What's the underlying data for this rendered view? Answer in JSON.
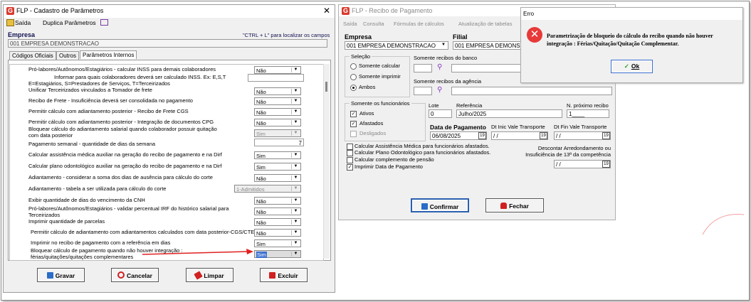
{
  "win1": {
    "title": "FLP - Cadastro de Parâmetros",
    "close": "✕",
    "toolbar": {
      "saida": "Saída",
      "duplica": "Duplica Parâmetros"
    },
    "empresa_label": "Empresa",
    "hint": "\"CTRL + L\" para localizar os campos",
    "empresa_value": "001 EMPRESA DEMONSTRACAO",
    "tabs": [
      "Códigos Oficiais",
      "Outros",
      "Parâmetros Internos"
    ],
    "rows": [
      {
        "text": "Pró-labores/Autônomos/Estagiários - calcular INSS para demais colaboradores",
        "value": "Não"
      },
      {
        "text": "Informar para quais colaboradores deverá ser calculado INSS. Ex: E,S,T",
        "value": ""
      },
      {
        "text": "E=Estagiários, S=Prestadores de Serviços, T=Terceirizados",
        "value": null
      },
      {
        "text": "Unificar Terceirizados vinculados a Tomador de frete",
        "value": "Não"
      },
      {
        "text": "Recibo de Frete - Insuficiência deverá ser consolidada no pagamento",
        "value": "Não"
      },
      {
        "text": "Permitir cálculo com adiantamento posterior - Recibo de Frete CGS",
        "value": "Não"
      },
      {
        "text": "Permitir cálculo com adiantamento posterior - Integração de documentos CPG",
        "value": "Não"
      },
      {
        "text": "Bloquear cálculo do adiantamento salarial quando colaborador possuir quitação",
        "value": "Sim"
      },
      {
        "text": "com data posterior",
        "value": null
      },
      {
        "text": "Pagamento semanal - quantidade de dias da  semana",
        "value": "7"
      },
      {
        "text": "Calcular assistência médica auxiliar na geração do recibo de pagamento e na Dirf",
        "value": "Sim"
      },
      {
        "text": "Calcular plano odontológico auxiliar na geração do recibo de pagamento e na Dirf",
        "value": "Sim"
      },
      {
        "text": "Adiantamento - considerar a soma dos dias de ausência para cálculo do corte",
        "value": "Não"
      },
      {
        "text": "Adiantamento - tabela a ser utilizada para cálculo do corte",
        "value": "1-Admitidos"
      },
      {
        "text": "Exibir quantidade de dias do vencimento da CNH",
        "value": "Não"
      },
      {
        "text": "Pró-labores/Autônomos/Estagiários - validar percentual IRF do  histórico salarial para",
        "value": "Não"
      },
      {
        "text": "Terceirizados",
        "value": null
      },
      {
        "text": "Imprimir quantidade de parcelas",
        "value": "Não"
      },
      {
        "text": "Permitir cálculo de adiantamento com adiantamentos calculados com data posterior-CGS/CTE",
        "value": "Não"
      },
      {
        "text": "Imprimir no recibo de pagamento com a referência em dias",
        "value": "Sim"
      },
      {
        "text": "Bloquear cálculo de pagamento quando não houver integração :",
        "value": "Sim"
      },
      {
        "text": "férias/quitações/quitações complementares",
        "value": null
      }
    ],
    "buttons": {
      "gravar": "Gravar",
      "cancelar": "Cancelar",
      "limpar": "Limpar",
      "excluir": "Excluir"
    }
  },
  "win2": {
    "title": "FLP - Recibo de Pagamento",
    "menu": [
      "Saída",
      "Consulta",
      "Fórmulas de cálculos",
      "Atualização de tabelas"
    ],
    "empresa_label": "Empresa",
    "empresa_value": "001 EMPRESA DEMONSTRACAO",
    "filial_label": "Filial",
    "filial_value": "001 EMPRESA DEMONSTRACAO",
    "selecao_label": "Seleção",
    "radios": [
      "Somente calcular",
      "Somente imprimir",
      "Ambos"
    ],
    "banco_label": "Somente recibos do banco",
    "agencia_label": "Somente recibos da agência",
    "funcionarios_label": "Somente os funcionários",
    "checks": [
      "Ativos",
      "Afastados",
      "Desligados"
    ],
    "lote_label": "Lote",
    "lote_value": "0",
    "referencia_label": "Referência",
    "referencia_value": "Julho/2025",
    "nproximo_label": "N. próximo recibo",
    "nproximo_value": "1____",
    "data_pag_label": "Data de Pagamento",
    "data_pag_value": "06/08/2025",
    "dt_inic_label": "Dt Inic Vale Transporte",
    "dt_inic_value": "/ /",
    "dt_fin_label": "Dt Fin Vale Transporte",
    "dt_fin_value": "/ /",
    "options": [
      "Calcular Assistência Médica para funcionários afastados.",
      "Calcular Plano Odontológico para funcionários afastados.",
      "Calcular complemento de pensão",
      "Imprimir Data de Pagamento"
    ],
    "descontar_label1": "Descontar Arredondamento ou",
    "descontar_label2": "Insuficiência de 13ª da competência",
    "descontar_value": "/ /",
    "confirmar": "Confirmar",
    "fechar": "Fechar"
  },
  "error": {
    "title": "Erro",
    "message1": "Parametrização de bloqueio do cálculo do recibo quando não houver",
    "message2": "integração : Férias/Quitação/Quitação Complementar.",
    "ok": "Ok"
  },
  "colors": {
    "accent": "#d83a2f",
    "link_blue": "#2a3fa0",
    "error_red": "#e8393a",
    "arrow_red": "#e02020"
  }
}
